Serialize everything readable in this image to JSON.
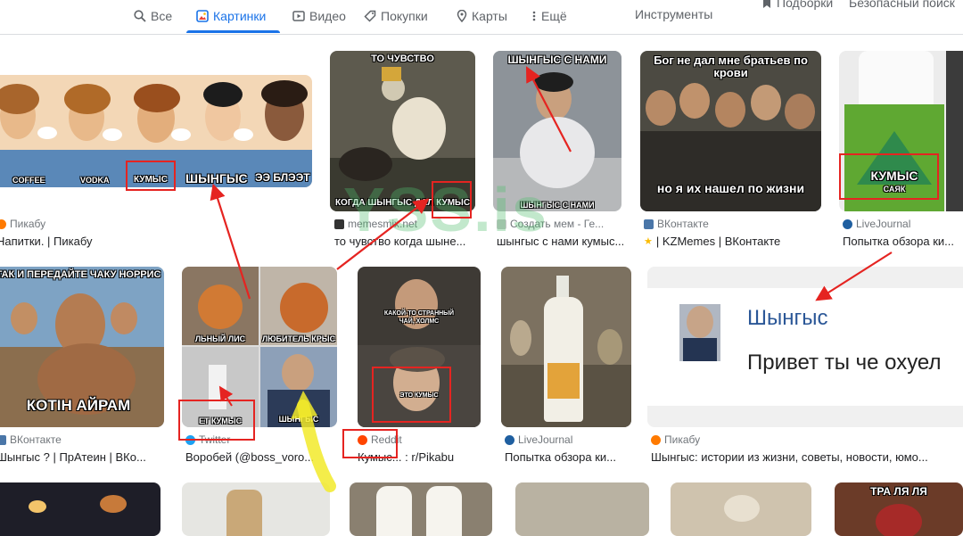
{
  "nav": {
    "tabs": [
      {
        "label": "Все",
        "icon": "search-icon",
        "active": false
      },
      {
        "label": "Картинки",
        "icon": "images-icon",
        "active": true
      },
      {
        "label": "Видео",
        "icon": "video-icon",
        "active": false
      },
      {
        "label": "Покупки",
        "icon": "tag-icon",
        "active": false
      },
      {
        "label": "Карты",
        "icon": "map-pin-icon",
        "active": false
      },
      {
        "label": "Ещё",
        "icon": "more-vert-icon",
        "active": false
      }
    ],
    "tools": "Инструменты",
    "collections": "Подборки",
    "safesearch": "Безопасный поиск"
  },
  "results": {
    "r1": {
      "source": "Пикабу",
      "caption": "Напитки. | Пикабу",
      "labels": [
        "COFFEE",
        "VODKA",
        "КУМЫС",
        "ШЫНГЫС",
        "ЭЭ БЛЭЭТ"
      ]
    },
    "r2": {
      "source": "memesmix.net",
      "caption": "то чувство когда шыне...",
      "top": "ТО ЧУВСТВО",
      "bottom": "КОГДА ШЫНГЫС ДАЛ КУМЫС"
    },
    "r3": {
      "source": "Создать мем - Ге...",
      "caption": "шынгыс с нами кумыс...",
      "top": "ШЫНГЫС С НАМИ",
      "bottom": "ШЫНГЫС С НАМИ"
    },
    "r4": {
      "source": "ВКонтакте",
      "caption": "| KZMemes | ВКонтакте",
      "top": "Бог не дал мне братьев по крови",
      "bottom": "но я их нашел по жизни"
    },
    "r5": {
      "source": "LiveJournal",
      "caption": "Попытка обзора ки...",
      "label": "КУМЫС",
      "sub": "САЯК"
    },
    "r6": {
      "source": "ВКонтакте",
      "caption": "Шынгыс ? | ПрАтеин | ВКо...",
      "top": "ТАК И ПЕРЕДАЙТЕ ЧАКУ НОРРИС",
      "bottom": "КОТІН АЙРАМ"
    },
    "r7": {
      "source": "Twitter",
      "caption": "Воробей (@boss_voro...",
      "labels": [
        "ЛЬНЫЙ ЛИС",
        "ЛЮБИТЕЛЬ КРЫС",
        "ЕТ КУМЫС",
        "ШЫНГЫС"
      ]
    },
    "r8": {
      "source": "Reddit",
      "caption": "Кумыс... : r/Pikabu",
      "top": "КАКОЙ-ТО СТРАННЫЙ ЧАЙ, ХОЛМС",
      "bottom": "ЭТО КУМЫС"
    },
    "r9": {
      "source": "LiveJournal",
      "caption": "Попытка обзора ки..."
    },
    "r10": {
      "source": "Пикабу",
      "caption": "Шынгыс: истории из жизни, советы, новости, юмо...",
      "name": "Шынгыс",
      "message": "Привет ты че охуел"
    },
    "r11": {
      "top": "ТРА ЛЯ ЛЯ"
    }
  },
  "watermark": "YSS.is"
}
